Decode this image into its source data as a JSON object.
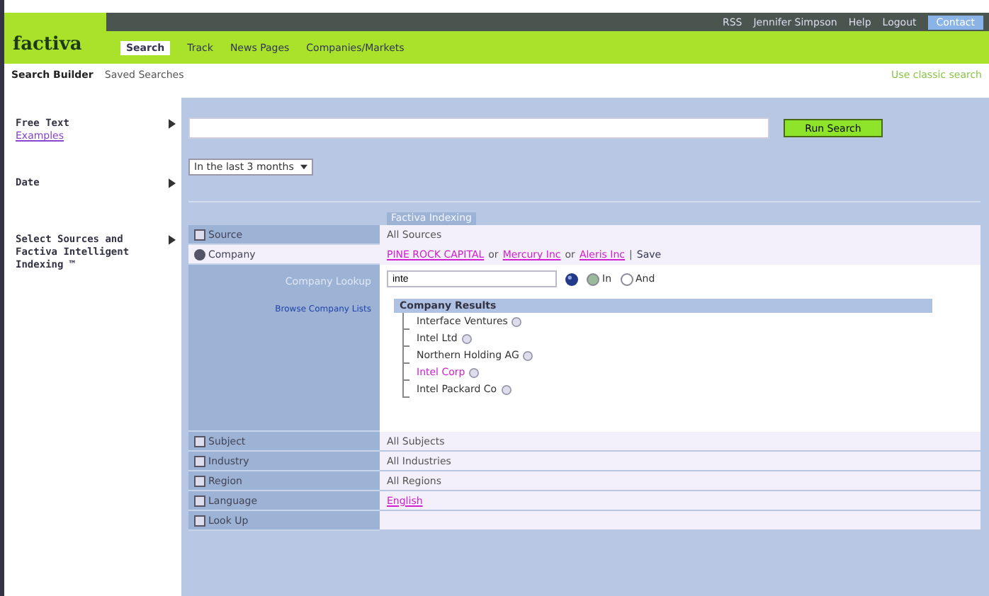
{
  "header": {
    "logo": "factiva",
    "links": [
      "RSS",
      "Jennifer Simpson",
      "Help",
      "Logout"
    ],
    "button": "Contact"
  },
  "tabs": [
    {
      "label": "Search",
      "selected": true
    },
    {
      "label": "Track",
      "selected": false
    },
    {
      "label": "News Pages",
      "selected": false
    },
    {
      "label": "Companies/Markets",
      "selected": false
    }
  ],
  "subnav": {
    "items": [
      {
        "label": "Search Builder",
        "selected": true
      },
      {
        "label": "Saved Searches",
        "selected": false
      }
    ],
    "right_link": "Use classic search"
  },
  "sections": [
    {
      "label": "Free Text",
      "link": "Examples"
    },
    {
      "label": "Date"
    },
    {
      "label": "Select Sources and Factiva Intelligent Indexing ™"
    }
  ],
  "search": {
    "run_button": "Run Search",
    "date": "In the last 3 months"
  },
  "indexing": {
    "title": "Factiva Indexing",
    "rows": [
      {
        "label": "Source",
        "value": "All Sources",
        "expanded": false,
        "kind": "text"
      },
      {
        "label": "Company",
        "expanded": true,
        "kind": "links",
        "parts": [
          {
            "text": "PINE ROCK CAPITAL",
            "kind": "link"
          },
          {
            "text": "or",
            "kind": "text"
          },
          {
            "text": "Mercury Inc",
            "kind": "link"
          },
          {
            "text": "or",
            "kind": "text"
          },
          {
            "text": "Aleris Inc",
            "kind": "link"
          },
          {
            "text": "|",
            "kind": "text"
          },
          {
            "text": "Save",
            "kind": "action"
          }
        ]
      }
    ],
    "lookup": {
      "title": "Company Lookup",
      "browse": "Browse Company Lists",
      "query": "inte",
      "options": [
        {
          "label": "In",
          "selected": true
        },
        {
          "label": "And",
          "selected": false
        }
      ],
      "results_title": "Company Results",
      "results": [
        {
          "name": "Interface Ventures",
          "visited": false
        },
        {
          "name": "Intel Ltd",
          "visited": false
        },
        {
          "name": "Northern Holding AG",
          "visited": false
        },
        {
          "name": "Intel Corp",
          "visited": true
        },
        {
          "name": "Intel Packard Co",
          "visited": false
        }
      ]
    },
    "bottom_rows": [
      {
        "label": "Subject",
        "value": "All Subjects",
        "kind": "text"
      },
      {
        "label": "Industry",
        "value": "All Industries",
        "kind": "text"
      },
      {
        "label": "Region",
        "value": "All Regions",
        "kind": "text"
      },
      {
        "label": "Language",
        "value": "English",
        "kind": "link"
      },
      {
        "label": "Look Up",
        "kind": "empty"
      }
    ]
  }
}
